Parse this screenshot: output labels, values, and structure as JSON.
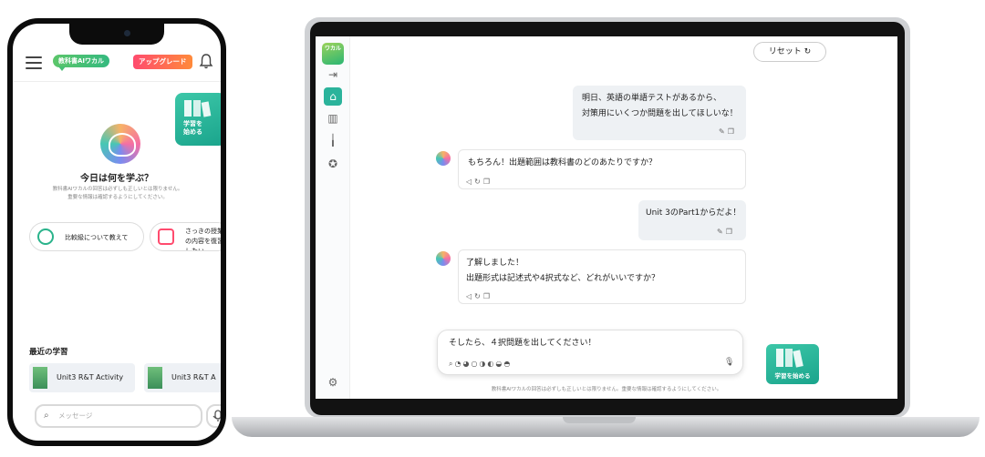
{
  "phone": {
    "logo": "教科書AIワカル",
    "upgrade": "アップグレード",
    "study_card": "学習を\n始める",
    "title": "今日は何を学ぶ？",
    "disclaimer": "教科書AIワカルの回答は必ずしも正しいとは限りません。\n重要な情報は確認するようにしてください。",
    "suggestions": [
      "比較級について教えて",
      "さっきの授業の内容を復習したい"
    ],
    "recent_title": "最近の学習",
    "recent": [
      "Unit3 R&T Activity",
      "Unit3 R&T A"
    ],
    "message_placeholder": "メッセージ"
  },
  "laptop": {
    "sidebar_logo": "ワカル",
    "reset": "リセット",
    "messages": [
      {
        "role": "user",
        "lines": [
          "明日、英語の単語テストがあるから、",
          "対策用にいくつか問題を出してほしいな！"
        ]
      },
      {
        "role": "ai",
        "lines": [
          "もちろん！出題範囲は教科書のどのあたりですか？"
        ]
      },
      {
        "role": "user",
        "lines": [
          "Unit 3のPart1からだよ！"
        ]
      },
      {
        "role": "ai",
        "lines": [
          "了解しました！",
          "出題形式は記述式や4択式など、どれがいいですか？"
        ]
      }
    ],
    "input_text": "そしたら、４択問題を出してください！",
    "study_button": "学習を始める",
    "footnote": "教科書AIワカルの回答は必ずしも正しいとは限りません。重要な情報は確認するようにしてください。"
  },
  "icons": [
    "hamburger-icon",
    "bell-icon",
    "sidebar-collapse-icon",
    "home-icon",
    "library-icon",
    "stats-icon",
    "badge-icon",
    "settings-icon",
    "reset-icon",
    "edit-icon",
    "copy-icon",
    "speaker-icon",
    "refresh-icon",
    "attach-icon",
    "mic-icon"
  ],
  "colors": {
    "accent": "#2bb39b",
    "upgrade": "#ff5a5a",
    "bubble_user": "#eef1f4"
  }
}
